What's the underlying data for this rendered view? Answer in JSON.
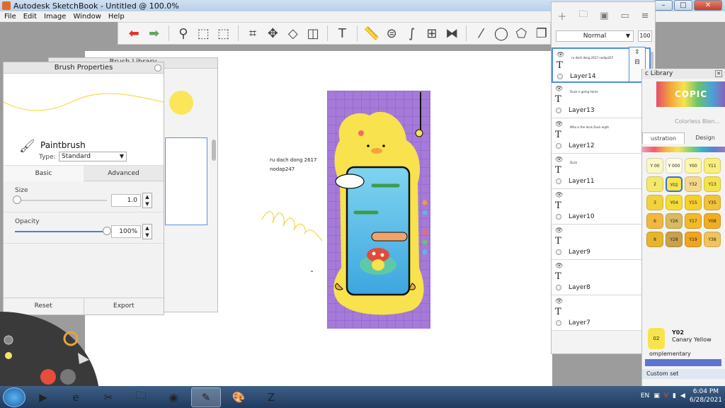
{
  "window": {
    "title": "Autodesk SketchBook - Untitled @ 100.0%"
  },
  "menubar": [
    "File",
    "Edit",
    "Image",
    "Window",
    "Help"
  ],
  "toolbar": {
    "tools": [
      {
        "name": "undo-icon",
        "glyph": "⬅",
        "style": "red"
      },
      {
        "name": "redo-icon",
        "glyph": "➡",
        "style": "green"
      },
      {
        "name": "zoom-icon",
        "glyph": "⚲"
      },
      {
        "name": "select-icon",
        "glyph": "⬚"
      },
      {
        "name": "select-red-icon",
        "glyph": "⬚"
      },
      {
        "name": "crop-icon",
        "glyph": "⌗"
      },
      {
        "name": "transform-icon",
        "glyph": "✥"
      },
      {
        "name": "distort-icon",
        "glyph": "◇"
      },
      {
        "name": "fill-icon",
        "glyph": "◫"
      },
      {
        "name": "text-icon",
        "glyph": "T"
      },
      {
        "name": "ruler-icon",
        "glyph": "📏"
      },
      {
        "name": "ellipse-guide-icon",
        "glyph": "⊜"
      },
      {
        "name": "french-curve-icon",
        "glyph": "∫"
      },
      {
        "name": "perspective-icon",
        "glyph": "⊞"
      },
      {
        "name": "symmetry-icon",
        "glyph": "⧓"
      },
      {
        "name": "line-icon",
        "glyph": "⁄"
      },
      {
        "name": "circle-icon",
        "glyph": "◯"
      },
      {
        "name": "shapes-icon",
        "glyph": "⬠"
      },
      {
        "name": "copy-icon",
        "glyph": "❐"
      }
    ]
  },
  "brush_library": {
    "title": "Brush Library"
  },
  "brush_props": {
    "title": "Brush Properties",
    "brush_name": "Paintbrush",
    "type_label": "Type:",
    "type_value": "Standard",
    "tabs": [
      "Basic",
      "Advanced"
    ],
    "size_label": "Size",
    "size_value": "1.0",
    "size_fraction": 0.02,
    "opacity_label": "Opacity",
    "opacity_value": "100%",
    "opacity_fraction": 1.0,
    "reset_label": "Reset",
    "export_label": "Export"
  },
  "canvas": {
    "text_a": "ru dach dong 2617",
    "text_b": "nodap247"
  },
  "layers": {
    "blend_mode": "Normal",
    "opacity_label": "100",
    "items": [
      {
        "name": "Layer14",
        "thumb": "ru dach dong 2617\nnodap247",
        "active": true
      },
      {
        "name": "Layer13",
        "thumb": "Duck is going home"
      },
      {
        "name": "Layer12",
        "thumb": "Who is the duck\nDuck eight"
      },
      {
        "name": "Layer11",
        "thumb": "Duck"
      },
      {
        "name": "Layer10",
        "thumb": ""
      },
      {
        "name": "Layer9",
        "thumb": ""
      },
      {
        "name": "Layer8",
        "thumb": ""
      },
      {
        "name": "Layer7",
        "thumb": ""
      }
    ]
  },
  "copic": {
    "title": "c Library",
    "logo": "COPIC",
    "colorless": "Colorless Blen...",
    "tabs": [
      "ustration",
      "Design"
    ],
    "swatches": [
      {
        "code": "Y\n00",
        "color": "#fbf7c4"
      },
      {
        "code": "Y\n000",
        "color": "#fdfbe2"
      },
      {
        "code": "Y00",
        "color": "#fbf6a8"
      },
      {
        "code": "Y11",
        "color": "#f9ef7a"
      },
      {
        "code": "2",
        "color": "#f5e86a"
      },
      {
        "code": "Y02",
        "color": "#f7e34e",
        "selected": true
      },
      {
        "code": "Y32",
        "color": "#f5d98a"
      },
      {
        "code": "Y13",
        "color": "#f4e449"
      },
      {
        "code": "3",
        "color": "#f2d23c"
      },
      {
        "code": "Y04",
        "color": "#f3dc3a"
      },
      {
        "code": "Y15",
        "color": "#f5cf2c"
      },
      {
        "code": "Y35",
        "color": "#f1c23a"
      },
      {
        "code": "6",
        "color": "#f0b840"
      },
      {
        "code": "Y26",
        "color": "#d8ba5f"
      },
      {
        "code": "Y17",
        "color": "#f2b929"
      },
      {
        "code": "Y08",
        "color": "#f2ad20"
      },
      {
        "code": "8",
        "color": "#e6b52f"
      },
      {
        "code": "Y28",
        "color": "#c9a14b"
      },
      {
        "code": "Y19",
        "color": "#f0a41f"
      },
      {
        "code": "Y38",
        "color": "#f0c45b"
      }
    ],
    "current_code": "02",
    "current_name": "Y02",
    "current_full": "Canary Yellow",
    "complementary": "omplementary",
    "custom_set": "Custom set"
  },
  "taskbar": {
    "apps": [
      {
        "name": "media-player-icon",
        "glyph": "▶"
      },
      {
        "name": "internet-explorer-icon",
        "glyph": "e"
      },
      {
        "name": "snipping-tool-icon",
        "glyph": "✂"
      },
      {
        "name": "file-explorer-icon",
        "glyph": "🗀"
      },
      {
        "name": "chrome-icon",
        "glyph": "◉"
      },
      {
        "name": "sketchbook-icon",
        "glyph": "✎",
        "active": true
      },
      {
        "name": "paint-icon",
        "glyph": "🎨"
      },
      {
        "name": "zalo-icon",
        "glyph": "Z"
      }
    ],
    "lang": "EN",
    "time": "6:04 PM",
    "date": "6/28/2021"
  },
  "colors": {
    "accent": "#4a8fdc",
    "artwork_purple": "#a57ad8",
    "artwork_yellow": "#f8e24d"
  }
}
